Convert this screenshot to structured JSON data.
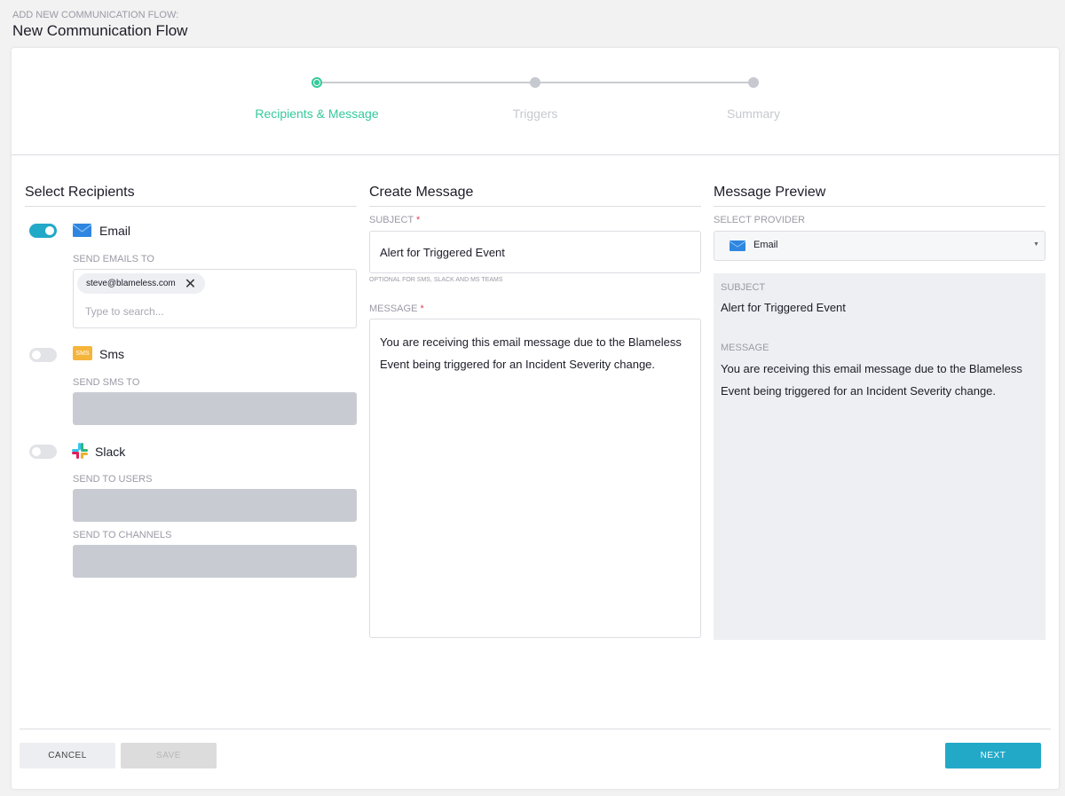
{
  "header": {
    "overline": "ADD NEW COMMUNICATION FLOW:",
    "title": "New Communication Flow"
  },
  "steps": [
    {
      "label": "Recipients & Message",
      "active": true
    },
    {
      "label": "Triggers",
      "active": false
    },
    {
      "label": "Summary",
      "active": false
    }
  ],
  "recipients": {
    "title": "Select Recipients",
    "email": {
      "label": "Email",
      "enabled": true,
      "field_label": "SEND EMAILS TO",
      "chip": "steve@blameless.com",
      "placeholder": "Type to search..."
    },
    "sms": {
      "label": "Sms",
      "enabled": false,
      "field_label": "SEND SMS TO",
      "icon_text": "SMS"
    },
    "slack": {
      "label": "Slack",
      "enabled": false,
      "users_label": "SEND TO USERS",
      "channels_label": "SEND TO CHANNELS"
    }
  },
  "message": {
    "title": "Create Message",
    "subject_label": "SUBJECT",
    "required": "*",
    "subject": "Alert for Triggered Event",
    "subject_hint": "OPTIONAL FOR SMS, SLACK AND MS TEAMS",
    "message_label": "MESSAGE",
    "message": "You are receiving this email message due to the Blameless Event being triggered for an Incident Severity change."
  },
  "preview": {
    "title": "Message Preview",
    "provider_label": "SELECT PROVIDER",
    "provider": "Email",
    "subject_label": "SUBJECT",
    "subject": "Alert for Triggered Event",
    "message_label": "MESSAGE",
    "message": "You are receiving this email message due to the Blameless Event being triggered for an Incident Severity change."
  },
  "footer": {
    "cancel": "CANCEL",
    "save": "SAVE",
    "next": "NEXT"
  },
  "colors": {
    "accent": "#22a9c8",
    "step_active": "#36c99a"
  }
}
